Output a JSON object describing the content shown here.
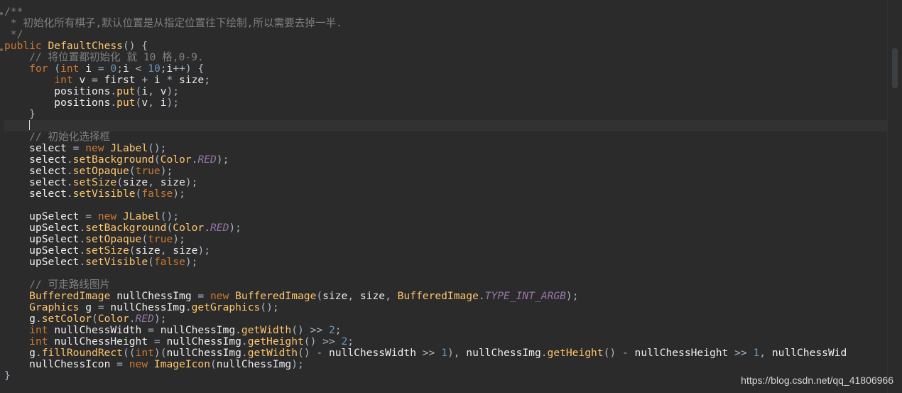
{
  "editor": {
    "lines": [
      "/**",
      " * 初始化所有棋子,默认位置是从指定位置往下绘制,所以需要去掉一半.",
      " */",
      "public DefaultChess() {",
      "    // 将位置都初始化 就 10 格,0-9.",
      "    for (int i = 0;i < 10;i++) {",
      "        int v = first + i * size;",
      "        positions.put(i, v);",
      "        positions.put(v, i);",
      "    }",
      "    |",
      "    // 初始化选择框",
      "    select = new JLabel();",
      "    select.setBackground(Color.RED);",
      "    select.setOpaque(true);",
      "    select.setSize(size, size);",
      "    select.setVisible(false);",
      "",
      "    upSelect = new JLabel();",
      "    upSelect.setBackground(Color.RED);",
      "    upSelect.setOpaque(true);",
      "    upSelect.setSize(size, size);",
      "    upSelect.setVisible(false);",
      "",
      "    // 可走路线图片",
      "    BufferedImage nullChessImg = new BufferedImage(size, size, BufferedImage.TYPE_INT_ARGB);",
      "    Graphics g = nullChessImg.getGraphics();",
      "    g.setColor(Color.RED);",
      "    int nullChessWidth = nullChessImg.getWidth() >> 2;",
      "    int nullChessHeight = nullChessImg.getHeight() >> 2;",
      "    g.fillRoundRect((int)(nullChessImg.getWidth() - nullChessWidth >> 1), nullChessImg.getHeight() - nullChessHeight >> 1, nullChessWid",
      "    nullChessIcon = new ImageIcon(nullChessImg);",
      "}"
    ],
    "current_line_index": 10
  },
  "watermark": "https://blog.csdn.net/qq_41806966",
  "colors": {
    "background": "#2b2b2b",
    "comment": "#808080",
    "keyword": "#cc7832",
    "method": "#ffc66d",
    "number": "#6897bb"
  }
}
